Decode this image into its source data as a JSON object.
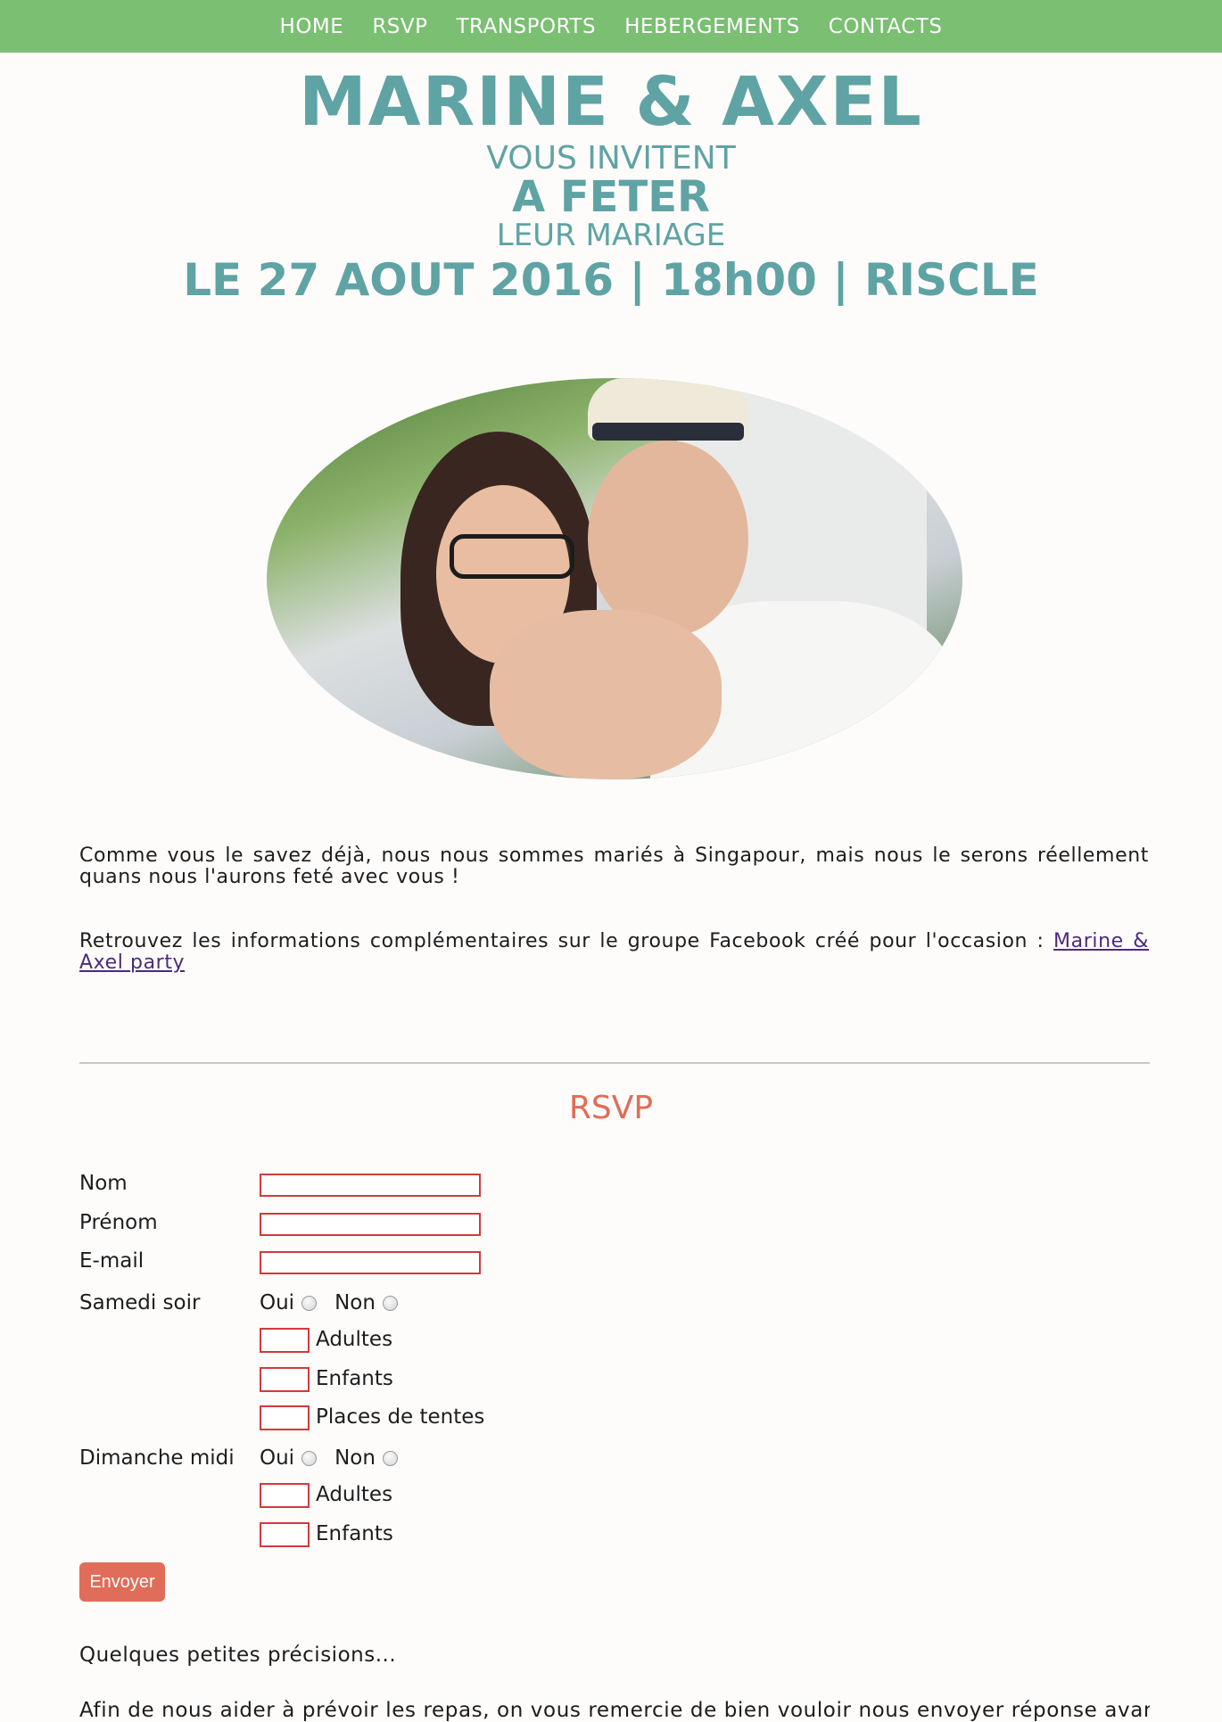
{
  "nav": {
    "items": [
      "HOME",
      "RSVP",
      "TRANSPORTS",
      "HEBERGEMENTS",
      "CONTACTS"
    ]
  },
  "hero": {
    "names": "MARINE & AXEL",
    "invite": "VOUS INVITENT",
    "feter": "A FETER",
    "leur": "LEUR MARIAGE",
    "date": "LE 27 AOUT 2016 | 18h00 | RISCLE"
  },
  "intro": {
    "paragraph1": "Comme vous le savez déjà, nous nous sommes mariés à Singapour, mais nous le serons réellement quans nous l'aurons feté avec vous !",
    "paragraph2_prefix": "Retrouvez les informations complémentaires sur le groupe Facebook créé pour l'occasion : ",
    "paragraph2_link": "Marine & Axel party"
  },
  "rsvp": {
    "title": "RSVP",
    "labels": {
      "nom": "Nom",
      "prenom": "Prénom",
      "email": "E-mail",
      "samedi": "Samedi soir",
      "dimanche": "Dimanche midi"
    },
    "yes": "Oui",
    "no": "Non",
    "samedi_fields": [
      "Adultes",
      "Enfants",
      "Places de tentes"
    ],
    "dimanche_fields": [
      "Adultes",
      "Enfants"
    ],
    "submit": "Envoyer"
  },
  "footer": {
    "note": "Quelques petites précisions...",
    "cut_text": "Afin de nous aider à prévoir les repas, on vous remercie de bien vouloir nous envoyer réponse avant le"
  },
  "colors": {
    "nav": "#7abf72",
    "hero_text": "#5fa3a4",
    "rsvp_title": "#e06d57",
    "field_border": "#d23a3a",
    "button": "#e06d5a"
  }
}
